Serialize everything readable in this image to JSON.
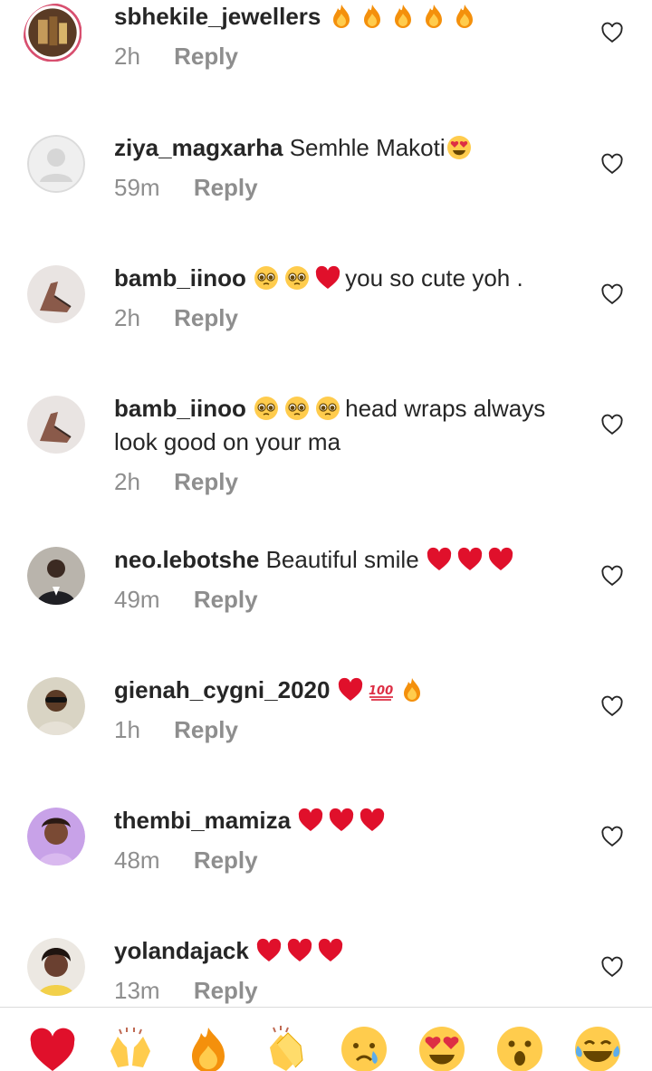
{
  "comments": [
    {
      "username": "sbhekile_jewellers",
      "text": "",
      "emojis_after": [
        "fire",
        "fire",
        "fire",
        "fire",
        "fire"
      ],
      "time": "2h",
      "reply": "Reply",
      "avatar": "jewellery-store-avatar"
    },
    {
      "username": "ziya_magxarha",
      "text": "Semhle Makoti",
      "emojis_after": [
        "heart-eyes"
      ],
      "time": "59m",
      "reply": "Reply",
      "avatar": "default-avatar"
    },
    {
      "username": "bamb_iinoo",
      "pre_emojis": [
        "pleading",
        "pleading",
        "red-heart"
      ],
      "text": "you so cute yoh .",
      "time": "2h",
      "reply": "Reply",
      "avatar": "shoe-avatar"
    },
    {
      "username": "bamb_iinoo",
      "pre_emojis": [
        "pleading",
        "pleading",
        "pleading"
      ],
      "text": "head wraps always look good on your ma",
      "time": "2h",
      "reply": "Reply",
      "avatar": "shoe-avatar"
    },
    {
      "username": "neo.lebotshe",
      "text": "Beautiful smile",
      "emojis_after": [
        "red-heart",
        "red-heart",
        "red-heart"
      ],
      "time": "49m",
      "reply": "Reply",
      "avatar": "man-suit-avatar"
    },
    {
      "username": "gienah_cygni_2020",
      "text": "",
      "emojis_after": [
        "red-heart",
        "hundred",
        "fire"
      ],
      "time": "1h",
      "reply": "Reply",
      "avatar": "man-sunglasses-avatar"
    },
    {
      "username": "thembi_mamiza",
      "text": "",
      "emojis_after": [
        "red-heart",
        "red-heart",
        "red-heart"
      ],
      "time": "48m",
      "reply": "Reply",
      "avatar": "woman-purple-avatar"
    },
    {
      "username": "yolandajack",
      "text": "",
      "emojis_after": [
        "red-heart",
        "red-heart",
        "red-heart"
      ],
      "time": "13m",
      "reply": "Reply",
      "avatar": "woman-avatar"
    }
  ],
  "reactions": [
    "red-heart",
    "raising-hands",
    "fire",
    "clapping-hands",
    "crying-face",
    "heart-eyes",
    "surprised-face",
    "tears-of-joy"
  ],
  "colors": {
    "username": "#262626",
    "meta": "#8e8e8e",
    "divider": "#dbdbdb",
    "heart": "#e0102b"
  }
}
